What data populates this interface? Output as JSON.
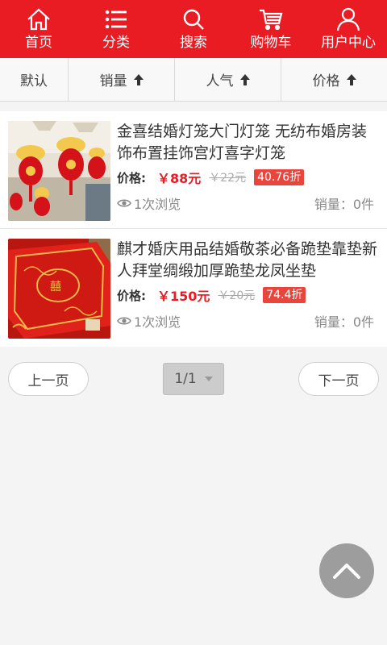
{
  "nav": {
    "items": [
      {
        "label": "首页",
        "icon": "home-icon"
      },
      {
        "label": "分类",
        "icon": "list-icon"
      },
      {
        "label": "搜索",
        "icon": "search-icon"
      },
      {
        "label": "购物车",
        "icon": "cart-icon"
      },
      {
        "label": "用户中心",
        "icon": "user-icon"
      }
    ]
  },
  "sort": {
    "default_label": "默认",
    "sales_label": "销量",
    "popularity_label": "人气",
    "price_label": "价格"
  },
  "products": [
    {
      "name": "金喜结婚灯笼大门灯笼 无纺布婚房装饰布置挂饰宫灯喜字灯笼",
      "price_label": "价格:",
      "price": "￥88元",
      "old_price": "￥22元",
      "discount": "40.76折",
      "views": "1次浏览",
      "sales": "销量：0件"
    },
    {
      "name": "麒才婚庆用品结婚敬茶必备跪垫靠垫新人拜堂绸缎加厚跪垫龙凤坐垫",
      "price_label": "价格:",
      "price": "￥150元",
      "old_price": "￥20元",
      "discount": "74.4折",
      "views": "1次浏览",
      "sales": "销量：0件"
    }
  ],
  "pager": {
    "prev_label": "上一页",
    "page_value": "1/1",
    "next_label": "下一页"
  },
  "colors": {
    "brand": "#e91c24",
    "discount_bg": "#e8453c"
  }
}
